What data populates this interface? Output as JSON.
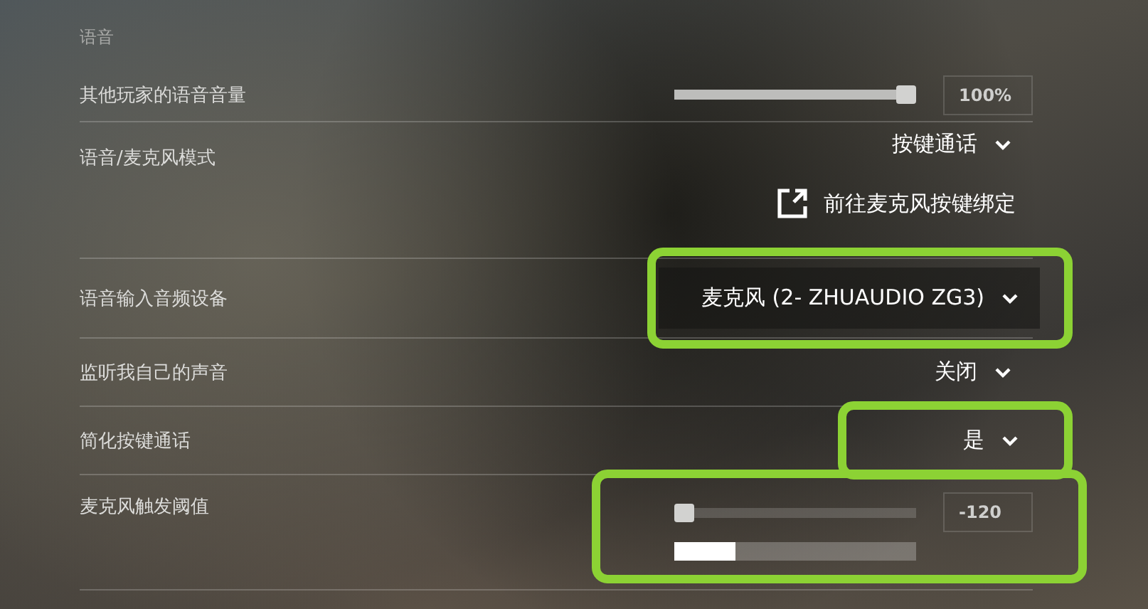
{
  "section": {
    "title": "语音"
  },
  "settings": [
    {
      "kind": "slider",
      "label": "其他玩家的语音音量",
      "level": 1,
      "reading": "100%",
      "highlighted": false
    },
    {
      "kind": "dropdown",
      "label": "语音/麦克风模式",
      "value": "按键通话",
      "hovered": false,
      "link": "前往麦克风按键绑定",
      "highlighted": false
    },
    {
      "kind": "dropdown",
      "label": "语音输入音频设备",
      "value": "麦克风 (2- ZHUAUDIO ZG3)",
      "hovered": true,
      "highlighted": true
    },
    {
      "kind": "dropdown",
      "label": "监听我自己的声音",
      "value": "关闭",
      "hovered": false,
      "highlighted": false
    },
    {
      "kind": "dropdown",
      "label": "简化按键通话",
      "value": "是",
      "hovered": false,
      "highlighted": true
    },
    {
      "kind": "threshold",
      "label": "麦克风触发阈值",
      "level": 0,
      "reading": "-120",
      "meter": {
        "level": 0.25
      },
      "highlighted": true
    }
  ]
}
